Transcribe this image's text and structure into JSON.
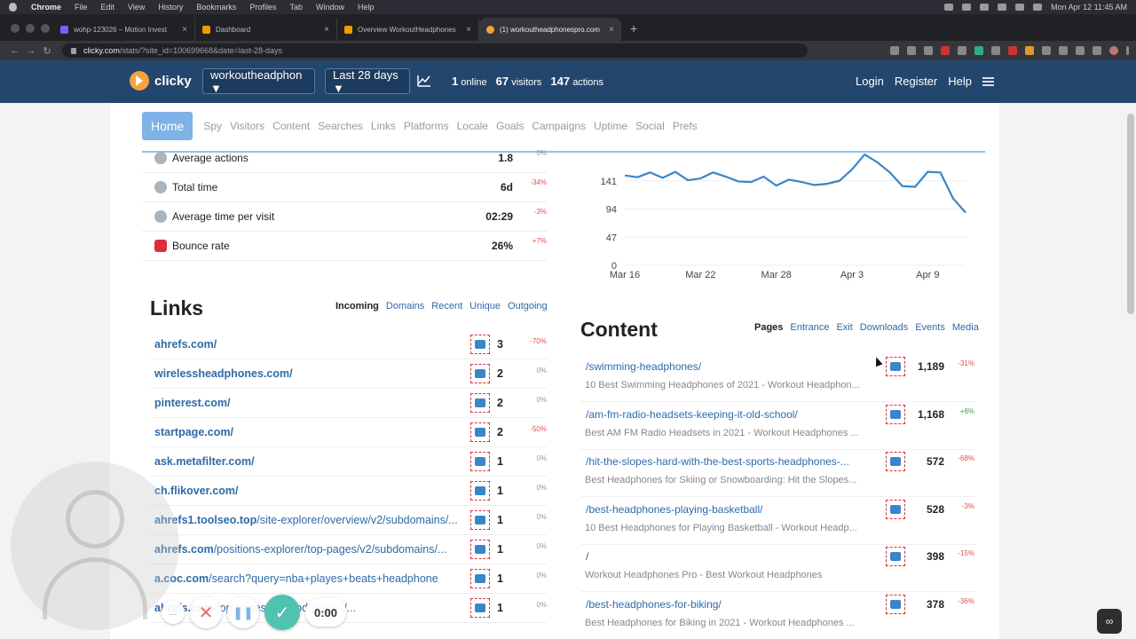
{
  "menubar": {
    "app": "Chrome",
    "items": [
      "File",
      "Edit",
      "View",
      "History",
      "Bookmarks",
      "Profiles",
      "Tab",
      "Window",
      "Help"
    ],
    "clock": "Mon Apr 12  11:45 AM"
  },
  "tabs": [
    {
      "title": "wohp-123026 – Motion Invest",
      "color": "#7b5cff"
    },
    {
      "title": "Dashboard",
      "color": "#f29900"
    },
    {
      "title": "Overview WorkoutHeadphones",
      "color": "#f29900"
    },
    {
      "title": "(1) workoutheadphonespro.com",
      "color": "#f5a33b"
    }
  ],
  "address": {
    "host": "clicky.com",
    "path": "/stats/?site_id=100699668&date=last-28-days"
  },
  "header": {
    "logo": "clicky",
    "site_select": "workoutheadphon ▼",
    "date_select": "Last 28 days ▼",
    "online": "1",
    "online_label": "online",
    "visitors": "67",
    "visitors_label": "visitors",
    "actions": "147",
    "actions_label": "actions",
    "login": "Login",
    "register": "Register",
    "help": "Help"
  },
  "subnav": {
    "home": "Home",
    "items": [
      "Spy",
      "Visitors",
      "Content",
      "Searches",
      "Links",
      "Platforms",
      "Locale",
      "Goals",
      "Campaigns",
      "Uptime",
      "Social",
      "Prefs"
    ]
  },
  "summary": [
    {
      "label": "Average actions",
      "value": "1.8",
      "pct": "0%",
      "trend": "flat",
      "icon": "actions-icon"
    },
    {
      "label": "Total time",
      "value": "6d",
      "pct": "-34%",
      "trend": "neg",
      "icon": "clock-icon"
    },
    {
      "label": "Average time per visit",
      "value": "02:29",
      "pct": "-3%",
      "trend": "neg",
      "icon": "clock-icon"
    },
    {
      "label": "Bounce rate",
      "value": "26%",
      "pct": "+7%",
      "trend": "neg",
      "icon": "bounce-icon"
    }
  ],
  "chart_data": {
    "type": "line",
    "y_ticks": [
      "141",
      "94",
      "47",
      "0"
    ],
    "x_ticks": [
      "Mar 16",
      "Mar 22",
      "Mar 28",
      "Apr 3",
      "Apr 9"
    ],
    "ylim": [
      0,
      188
    ],
    "x": [
      1,
      2,
      3,
      4,
      5,
      6,
      7,
      8,
      9,
      10,
      11,
      12,
      13,
      14,
      15,
      16,
      17,
      18,
      19,
      20,
      21,
      22,
      23,
      24,
      25,
      26,
      27,
      28
    ],
    "values": [
      150,
      147,
      155,
      146,
      156,
      142,
      145,
      155,
      148,
      140,
      139,
      148,
      133,
      143,
      139,
      134,
      136,
      141,
      160,
      185,
      172,
      155,
      132,
      131,
      156,
      155,
      112,
      88
    ],
    "color": "#3a86c8"
  },
  "links": {
    "title": "Links",
    "tabs": [
      "Incoming",
      "Domains",
      "Recent",
      "Unique",
      "Outgoing"
    ],
    "rows": [
      {
        "domain": "ahrefs.com/",
        "rest": "",
        "count": "3",
        "pct": "-70%",
        "trend": "neg"
      },
      {
        "domain": "wirelessheadphones.com/",
        "rest": "",
        "count": "2",
        "pct": "0%",
        "trend": "flat"
      },
      {
        "domain": "pinterest.com/",
        "rest": "",
        "count": "2",
        "pct": "0%",
        "trend": "flat"
      },
      {
        "domain": "startpage.com/",
        "rest": "",
        "count": "2",
        "pct": "-50%",
        "trend": "neg"
      },
      {
        "domain": "ask.metafilter.com/",
        "rest": "",
        "count": "1",
        "pct": "0%",
        "trend": "flat"
      },
      {
        "domain": "ch.flikover.com/",
        "rest": "",
        "count": "1",
        "pct": "0%",
        "trend": "flat"
      },
      {
        "domain": "ahrefs1.toolseo.top",
        "rest": "/site-explorer/overview/v2/subdomains/...",
        "count": "1",
        "pct": "0%",
        "trend": "flat"
      },
      {
        "domain": "ahrefs.com",
        "rest": "/positions-explorer/top-pages/v2/subdomains/...",
        "count": "1",
        "pct": "0%",
        "trend": "flat"
      },
      {
        "domain": "a.coc.com",
        "rest": "/search?query=nba+playes+beats+headphone",
        "count": "1",
        "pct": "0%",
        "trend": "flat"
      },
      {
        "domain": "ahrefs.com",
        "rest": "/top-pages/v2/subdomains/...",
        "count": "1",
        "pct": "0%",
        "trend": "flat"
      }
    ]
  },
  "content": {
    "title": "Content",
    "tabs": [
      "Pages",
      "Entrance",
      "Exit",
      "Downloads",
      "Events",
      "Media"
    ],
    "rows": [
      {
        "path": "/swimming-headphones/",
        "desc": "10 Best Swimming Headphones of 2021 - Workout Headphon...",
        "count": "1,189",
        "pct": "-31%",
        "trend": "neg"
      },
      {
        "path": "/am-fm-radio-headsets-keeping-it-old-school/",
        "desc": "Best AM FM Radio Headsets in 2021 - Workout Headphones ...",
        "count": "1,168",
        "pct": "+6%",
        "trend": "pos"
      },
      {
        "path": "/hit-the-slopes-hard-with-the-best-sports-headphones-...",
        "desc": "Best Headphones for Skiing or Snowboarding: Hit the Slopes...",
        "count": "572",
        "pct": "-68%",
        "trend": "neg"
      },
      {
        "path": "/best-headphones-playing-basketball/",
        "desc": "10 Best Headphones for Playing Basketball - Workout Headp...",
        "count": "528",
        "pct": "-3%",
        "trend": "neg"
      },
      {
        "path": "/",
        "desc": "Workout Headphones Pro - Best Workout Headphones",
        "count": "398",
        "pct": "-15%",
        "trend": "neg"
      },
      {
        "path": "/best-headphones-for-biking/",
        "desc": "Best Headphones for Biking in 2021 - Workout Headphones ...",
        "count": "378",
        "pct": "-36%",
        "trend": "neg"
      }
    ]
  },
  "recorder": {
    "timer": "0:00",
    "dots": "..."
  }
}
